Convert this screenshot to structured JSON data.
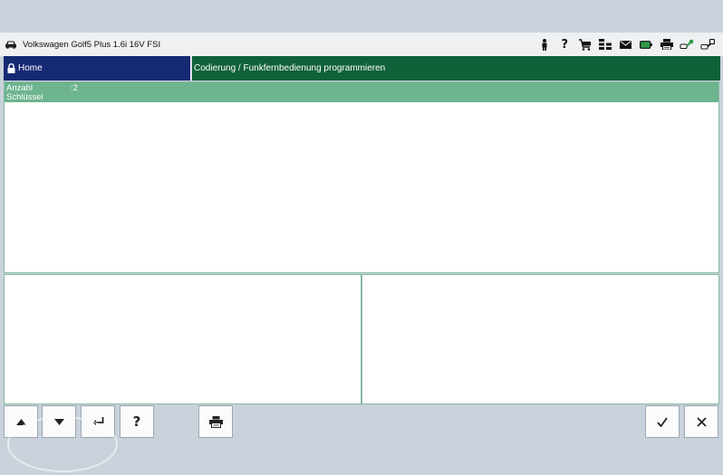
{
  "header": {
    "vehicle_title": "Volkswagen Golf5 Plus 1.6i 16V FSI",
    "icons": [
      "person-icon",
      "help-icon",
      "cart-icon",
      "hierarchy-icon",
      "mail-icon",
      "battery-icon",
      "printer-icon",
      "connection-icon",
      "diagnostic-tool-icon"
    ]
  },
  "nav": {
    "home_label": "Home",
    "breadcrumb": "Codierung / Funkfernbedienung programmieren"
  },
  "info": {
    "label_line1": "Anzahl",
    "label_line2": "Schlüssel",
    "value": ":2"
  },
  "buttons": {
    "help_label": "?"
  },
  "colors": {
    "home_bg": "#162a74",
    "breadcrumb_bg": "#10613a",
    "info_bar_bg": "#6db48f",
    "panel_border": "#86b9a0",
    "background": "#c9d2db"
  }
}
